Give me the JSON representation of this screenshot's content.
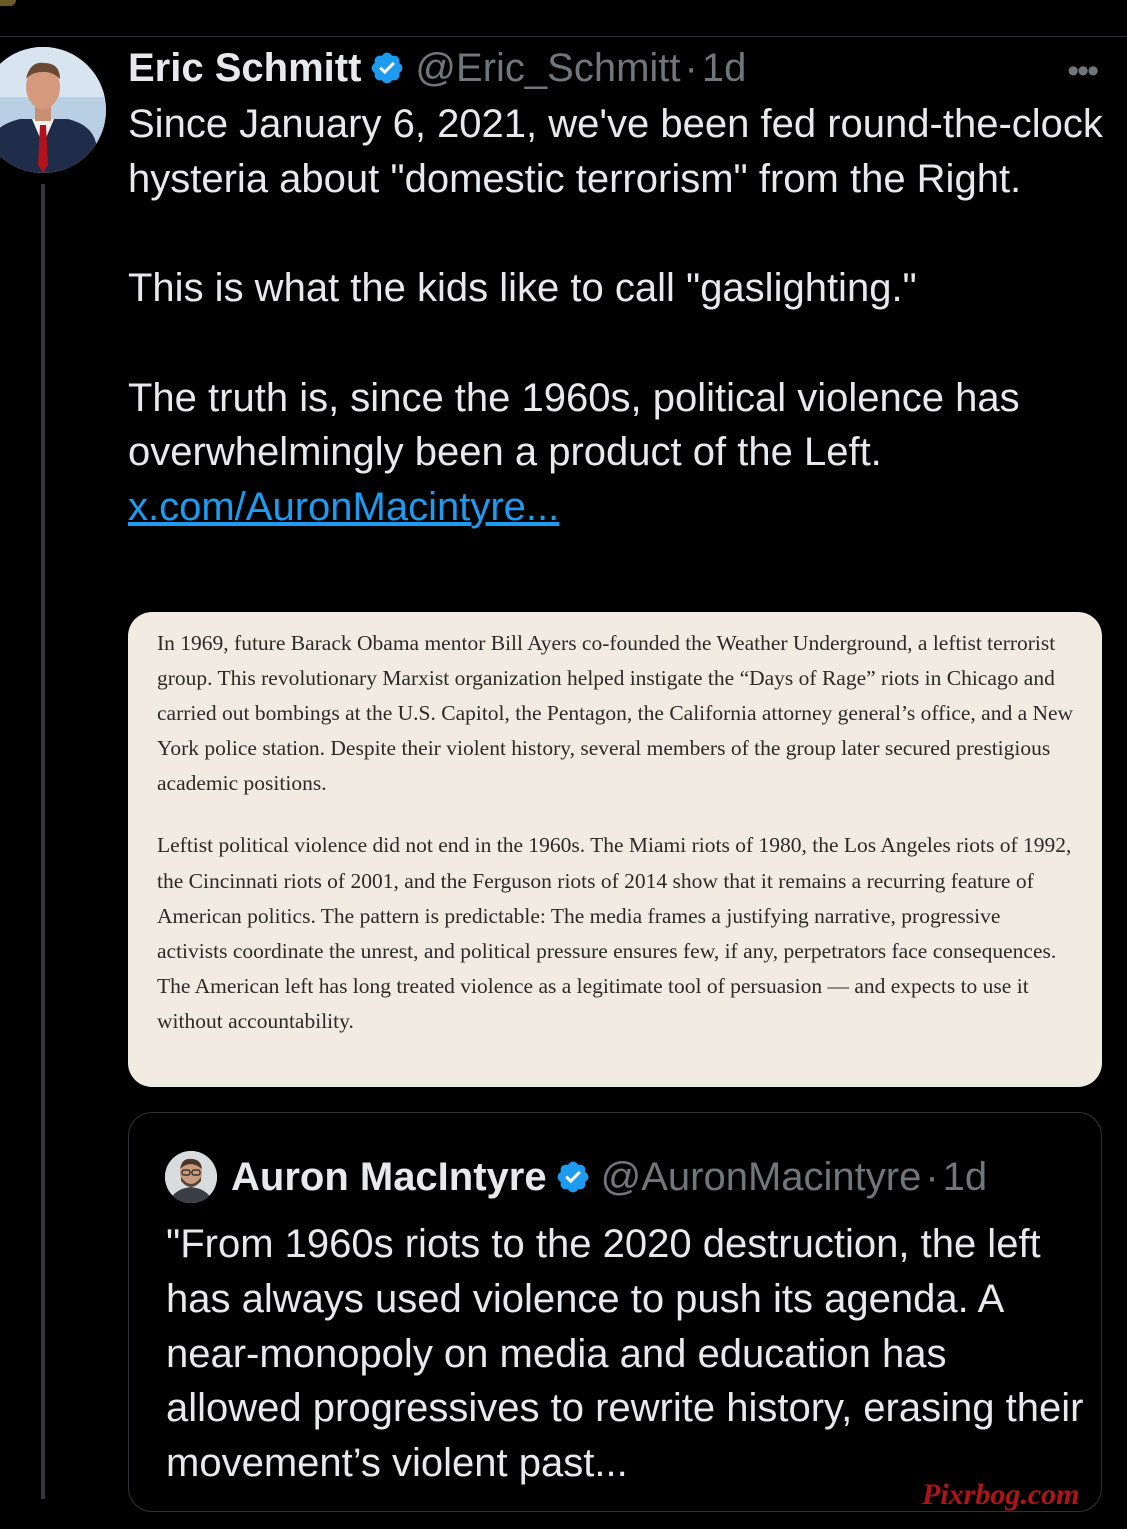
{
  "tweet": {
    "author_name": "Eric Schmitt",
    "handle": "@Eric_Schmitt",
    "separator": "·",
    "time": "1d",
    "more_label": "•••",
    "body": [
      "Since January 6, 2021, we've been fed round-the-clock hysteria about \"domestic terrorism\" from the Right.",
      "This is what the kids like to call \"gaslighting.\"",
      "The truth is, since the 1960s, political violence has overwhelmingly been a product of the Left."
    ],
    "link_text": "x.com/AuronMacintyre..."
  },
  "note_card": {
    "paragraphs": [
      "In 1969, future Barack Obama mentor Bill Ayers co-founded the Weather Underground, a leftist terrorist group. This revolutionary Marxist organization helped instigate the “Days of Rage” riots in Chicago and carried out bombings at the U.S. Capitol, the Pentagon, the California attorney general’s office, and a New York police station. Despite their violent history, several members of the group later secured prestigious academic positions.",
      "Leftist political violence did not end in the 1960s. The Miami riots of 1980, the Los Angeles riots of 1992, the Cincinnati riots of 2001, and the Ferguson riots of 2014 show that it remains a recurring feature of American politics. The pattern is predictable: The media frames a justifying narrative, progressive activists coordinate the unrest, and political pressure ensures few, if any, perpetrators face consequences. The American left has long treated violence as a legitimate tool of persuasion — and expects to use it without accountability."
    ]
  },
  "quoted": {
    "author_name": "Auron MacIntyre",
    "handle": "@AuronMacintyre",
    "separator": "·",
    "time": "1d",
    "body": "\"From 1960s riots to the 2020 destruction, the left has always used violence to push its agenda. A near-monopoly on media and education has allowed progressives to rewrite history, erasing their movement’s violent past..."
  },
  "watermark": "Pixrbog.com",
  "icons": {
    "verified": "verified-badge-icon",
    "more": "more-options-icon"
  },
  "colors": {
    "background": "#000000",
    "text": "#e7e9ea",
    "muted": "#71767b",
    "link": "#1d9bf0",
    "verified": "#1d9bf0",
    "card": "#f1ebe1"
  }
}
